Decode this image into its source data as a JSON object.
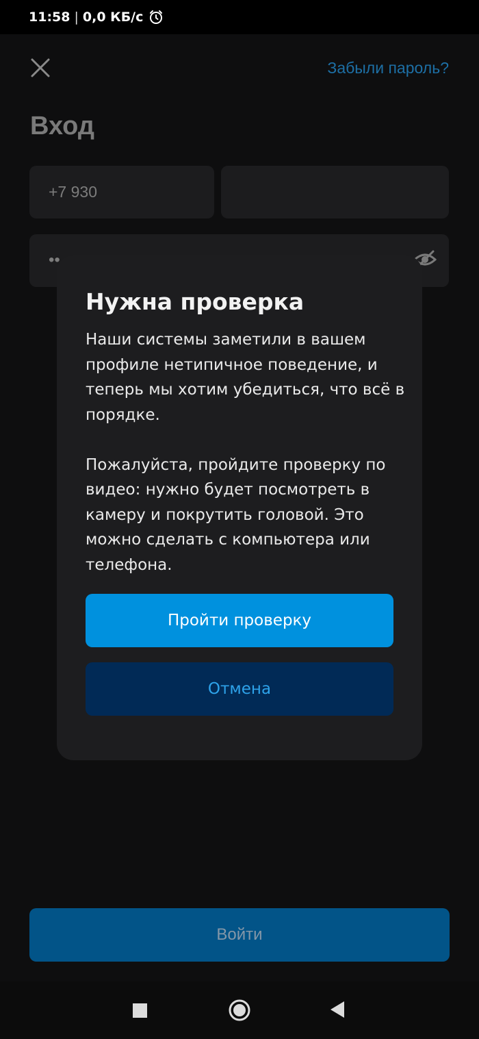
{
  "status_bar": {
    "time": "11:58",
    "network_speed": "0,0 КБ/с",
    "icons": [
      "alarm-icon"
    ]
  },
  "header": {
    "close_icon": "close-icon",
    "forgot_password": "Забыли пароль?",
    "title": "Вход"
  },
  "form": {
    "phone_value": "+7 930",
    "password_dots": "••",
    "password_toggle_icon": "eye-slash-icon"
  },
  "dialog": {
    "title": "Нужна проверка",
    "paragraph_1": "Наши системы заметили в вашем профиле нетипичное поведение, и теперь мы хотим убедиться, что всё в порядке.",
    "paragraph_2": "Пожалуйста, пройдите проверку по видео: нужно будет посмотреть в камеру и покрутить головой. Это можно сделать с компьютера или телефона.",
    "confirm_label": "Пройти проверку",
    "cancel_label": "Отмена"
  },
  "login_button_label": "Войти",
  "nav_bar": {
    "icons": [
      "recent-apps-icon",
      "home-icon",
      "back-icon"
    ]
  },
  "colors": {
    "accent": "#0091de",
    "cancel_bg": "#012a56",
    "cancel_text": "#2ea3ea",
    "link": "#1d6fa5",
    "dialog_bg": "#1d1d1f",
    "page_bg": "#0e0e0f"
  }
}
